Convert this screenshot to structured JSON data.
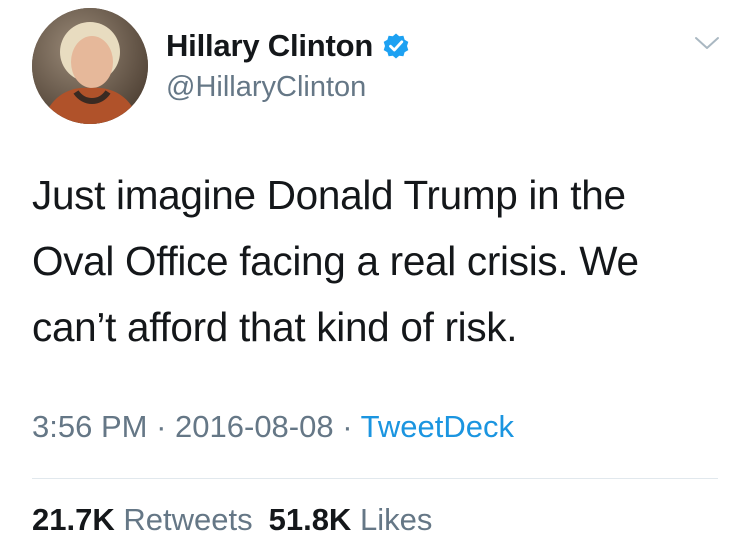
{
  "user": {
    "display_name": "Hillary Clinton",
    "handle": "@HillaryClinton",
    "verified": true,
    "avatar_icon": "profile-photo"
  },
  "tweet": {
    "lines": [
      "Just imagine Donald Trump in the",
      "Oval Office facing a real crisis. We",
      "can’t afford that kind of risk."
    ],
    "time": "3:56 PM",
    "separator": "·",
    "date": "2016-08-08",
    "source": "TweetDeck"
  },
  "stats": {
    "retweets_count": "21.7K",
    "retweets_label": "Retweets",
    "likes_count": "51.8K",
    "likes_label": "Likes"
  },
  "colors": {
    "text": "#14171a",
    "muted": "#657786",
    "link": "#1b95e0",
    "verified": "#1da1f2",
    "divider": "#e1e8ed"
  }
}
